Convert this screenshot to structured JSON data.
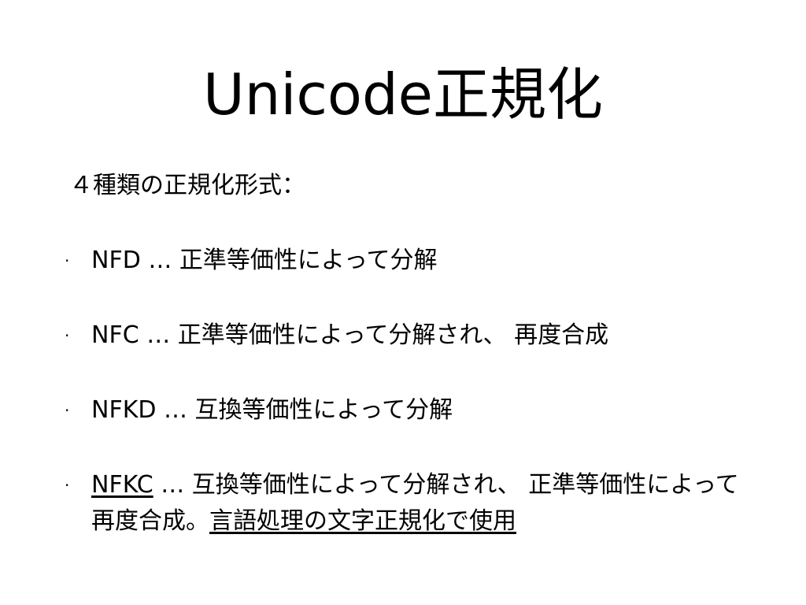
{
  "slide": {
    "title": "Unicode正規化",
    "subtitle": "４種類の正規化形式：",
    "bullet_marker": "·",
    "items": [
      {
        "name": "NFD",
        "desc": " … 正準等価性によって分解"
      },
      {
        "name": "NFC",
        "desc": " … 正準等価性によって分解され、 再度合成"
      },
      {
        "name": "NFKD",
        "desc": " … 互換等価性によって分解"
      },
      {
        "name": "NFKC",
        "desc": " … 互換等価性によって分解され、 正準等価性によって再度合成。",
        "note": "言語処理の文字正規化で使用"
      }
    ]
  }
}
